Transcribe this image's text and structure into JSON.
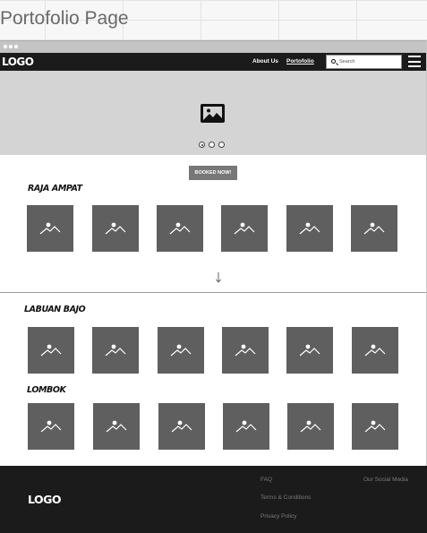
{
  "canvas": {
    "title": "Portofolio Page"
  },
  "navbar": {
    "logo": "LOGO",
    "links": [
      "About Us",
      "Portofolio"
    ],
    "active_link": "Portofolio",
    "search_placeholder": "Search"
  },
  "hero": {
    "carousel_dots": 3,
    "active_dot": 1
  },
  "book_button": "BOOKED NOW!",
  "sections": [
    {
      "label": "RAJA AMPAT",
      "thumbnails": 6
    },
    {
      "label": "LABUAN BAJO",
      "thumbnails": 6
    },
    {
      "label": "LOMBOK",
      "thumbnails": 6
    }
  ],
  "footer": {
    "logo": "LOGO",
    "links": [
      "FAQ",
      "Terms & Conditions",
      "Privacy Policy"
    ],
    "social": "Our Social Media"
  },
  "colors": {
    "nav_bg": "#1b1b1b",
    "hero_bg": "#d4d4d4",
    "thumbnail": "#5f5f5f",
    "button": "#777777",
    "footer_text": "#7a7a7a"
  }
}
